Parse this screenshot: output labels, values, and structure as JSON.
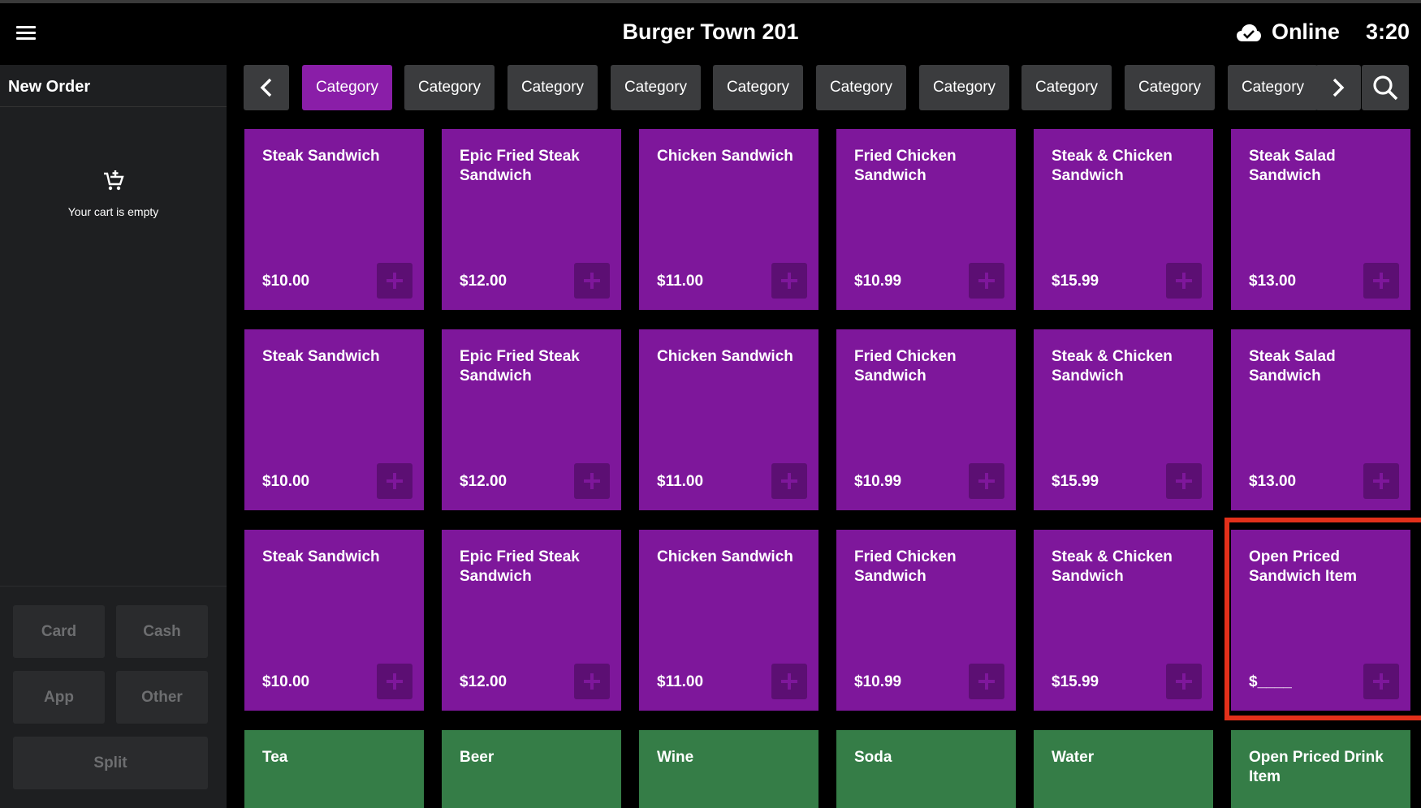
{
  "header": {
    "title": "Burger Town 201",
    "status": "Online",
    "time": "3:20"
  },
  "left": {
    "new_order": "New Order",
    "cart_empty": "Your cart is empty",
    "buttons": {
      "card": "Card",
      "cash": "Cash",
      "app": "App",
      "other": "Other",
      "split": "Split"
    }
  },
  "categories": [
    "Category",
    "Category",
    "Category",
    "Category",
    "Category",
    "Category",
    "Category",
    "Category",
    "Category",
    "Category"
  ],
  "items": [
    {
      "name": "Steak Sandwich",
      "price": "$10.00"
    },
    {
      "name": "Epic Fried Steak Sandwich",
      "price": "$12.00"
    },
    {
      "name": "Chicken Sandwich",
      "price": "$11.00"
    },
    {
      "name": "Fried Chicken Sandwich",
      "price": "$10.99"
    },
    {
      "name": "Steak & Chicken Sandwich",
      "price": "$15.99"
    },
    {
      "name": "Steak Salad Sandwich",
      "price": "$13.00"
    },
    {
      "name": "Steak Sandwich",
      "price": "$10.00"
    },
    {
      "name": "Epic Fried Steak Sandwich",
      "price": "$12.00"
    },
    {
      "name": "Chicken Sandwich",
      "price": "$11.00"
    },
    {
      "name": "Fried Chicken Sandwich",
      "price": "$10.99"
    },
    {
      "name": "Steak & Chicken Sandwich",
      "price": "$15.99"
    },
    {
      "name": "Steak Salad Sandwich",
      "price": "$13.00"
    },
    {
      "name": "Steak Sandwich",
      "price": "$10.00"
    },
    {
      "name": "Epic Fried Steak Sandwich",
      "price": "$12.00"
    },
    {
      "name": "Chicken Sandwich",
      "price": "$11.00"
    },
    {
      "name": "Fried Chicken Sandwich",
      "price": "$10.99"
    },
    {
      "name": "Steak & Chicken Sandwich",
      "price": "$15.99"
    },
    {
      "name": "Open Priced Sandwich Item",
      "price": "$____"
    }
  ],
  "drinks": [
    {
      "name": "Tea"
    },
    {
      "name": "Beer"
    },
    {
      "name": "Wine"
    },
    {
      "name": "Soda"
    },
    {
      "name": "Water"
    },
    {
      "name": "Open Priced Drink Item"
    }
  ],
  "icons": {
    "menu": "hamburger-menu-icon",
    "cloud": "cloud-check-icon",
    "cart": "add-cart-icon",
    "prev": "chevron-left-icon",
    "next": "chevron-right-icon",
    "search": "search-icon",
    "add": "plus-icon"
  },
  "colors": {
    "sandwich_tile": "#7e179b",
    "drink_tile": "#357d47",
    "active_category": "#8a1ea8",
    "highlight": "#e2301a"
  }
}
